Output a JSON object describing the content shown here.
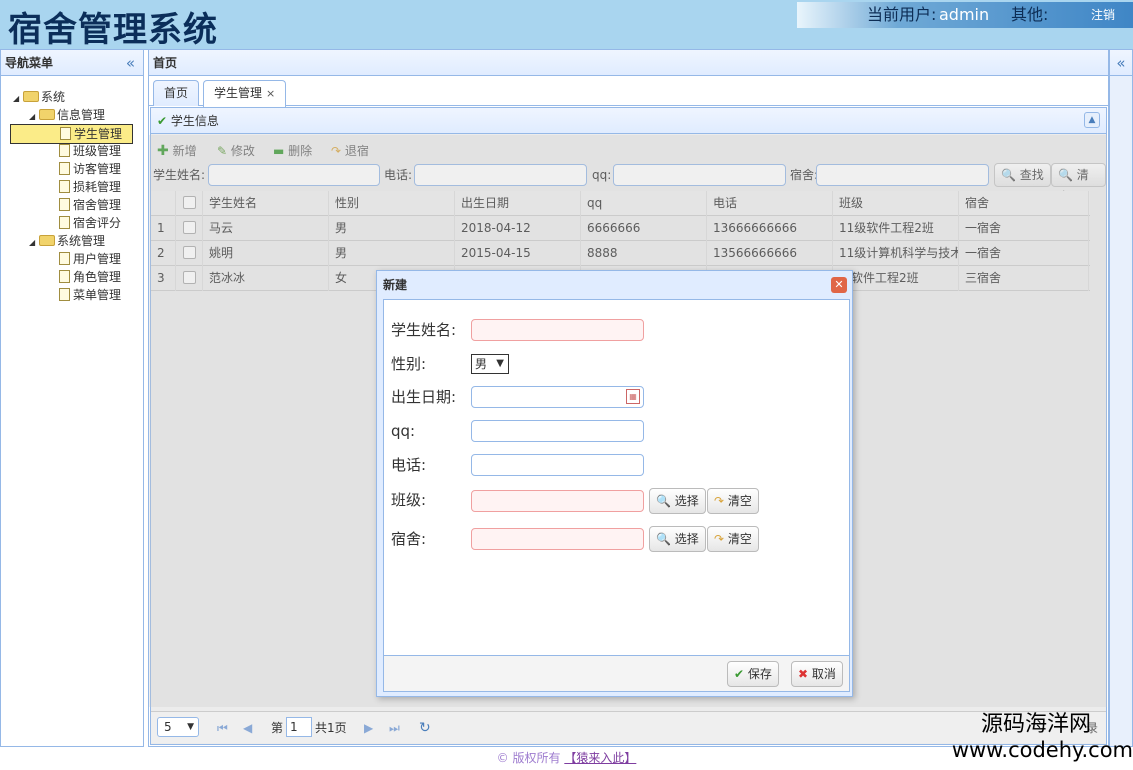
{
  "header": {
    "title": "宿舍管理系统",
    "user_label": "当前用户:",
    "user_name": "admin",
    "other_label": "其他:",
    "logout": "注销"
  },
  "nav": {
    "title": "导航菜单",
    "items": [
      {
        "label": "系统"
      },
      {
        "label": "信息管理"
      },
      {
        "label": "学生管理"
      },
      {
        "label": "班级管理"
      },
      {
        "label": "访客管理"
      },
      {
        "label": "损耗管理"
      },
      {
        "label": "宿舍管理"
      },
      {
        "label": "宿舍评分"
      },
      {
        "label": "系统管理"
      },
      {
        "label": "用户管理"
      },
      {
        "label": "角色管理"
      },
      {
        "label": "菜单管理"
      }
    ]
  },
  "center": {
    "title": "首页"
  },
  "tabs": [
    {
      "label": "首页"
    },
    {
      "label": "学生管理"
    }
  ],
  "panel": {
    "title": "学生信息",
    "toolbar": {
      "add": "新增",
      "edit": "修改",
      "delete": "删除",
      "checkout": "退宿"
    },
    "search": {
      "name_label": "学生姓名:",
      "phone_label": "电话:",
      "qq_label": "qq:",
      "dorm_label": "宿舍:",
      "find": "查找",
      "clear": "清空"
    },
    "columns": [
      "学生姓名",
      "性别",
      "出生日期",
      "qq",
      "电话",
      "班级",
      "宿舍"
    ],
    "rows": [
      {
        "num": "1",
        "name": "马云",
        "sex": "男",
        "birth": "2018-04-12",
        "qq": "6666666",
        "phone": "13666666666",
        "class": "11级软件工程2班",
        "dorm": "一宿舍"
      },
      {
        "num": "2",
        "name": "姚明",
        "sex": "男",
        "birth": "2015-04-15",
        "qq": "8888",
        "phone": "13566666666",
        "class": "11级计算机科学与技术",
        "dorm": "一宿舍"
      },
      {
        "num": "3",
        "name": "范冰冰",
        "sex": "女",
        "birth": "",
        "qq": "",
        "phone": "",
        "class": "级软件工程2班",
        "dorm": "三宿舍"
      }
    ],
    "pager": {
      "page_size": "5",
      "page_prefix": "第",
      "page_value": "1",
      "page_total": "共1页",
      "tail": "录"
    }
  },
  "dialog": {
    "title": "新建",
    "fields": {
      "name": "学生姓名:",
      "sex": "性别:",
      "birth": "出生日期:",
      "qq": "qq:",
      "phone": "电话:",
      "class": "班级:",
      "dorm": "宿舍:"
    },
    "sex_value": "男",
    "choose": "选择",
    "clear": "清空",
    "save": "保存",
    "cancel": "取消"
  },
  "footer": {
    "copyright": "© 版权所有",
    "link": "【猿来入此】"
  },
  "watermark": {
    "line1": "源码海洋网",
    "line2": "www.codehy.com"
  }
}
